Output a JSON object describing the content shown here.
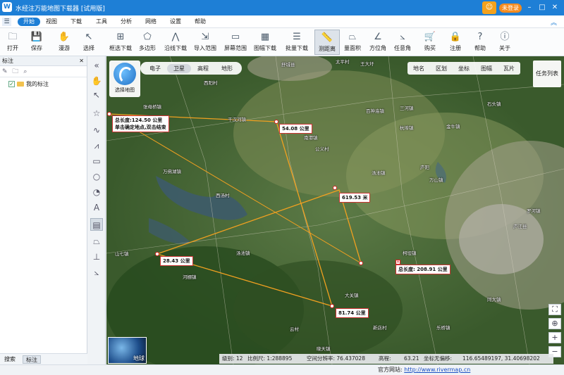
{
  "app": {
    "title": "水经注万能地图下载器 [试用版]",
    "login_label": "未登录"
  },
  "menu": {
    "items": [
      "开始",
      "视图",
      "下载",
      "工具",
      "分析",
      "网络",
      "设置",
      "帮助"
    ]
  },
  "toolbar": {
    "items": [
      "打开",
      "保存",
      "漫游",
      "选择",
      "框选下载",
      "多边形",
      "沿线下载",
      "导入范围",
      "屏幕范围",
      "图幅下载",
      "批量下载",
      "测距离",
      "量面积",
      "方位角",
      "任意角",
      "购买",
      "注册",
      "帮助",
      "关于"
    ],
    "active": "测距离"
  },
  "left_panel": {
    "title": "标注",
    "tree": [
      {
        "label": "我的标注",
        "checked": true
      }
    ],
    "tabs": [
      "搜索",
      "标注"
    ],
    "active_tab": "标注"
  },
  "map": {
    "select_map_label": "选择地图",
    "layers": [
      "电子",
      "卫星",
      "高程",
      "地形"
    ],
    "active_layer": "卫星",
    "overlays": [
      "地名",
      "区划",
      "坐标",
      "图幅",
      "瓦片"
    ],
    "task_list": "任务列表",
    "thumbnail_label": "地球",
    "places": [
      "舒城县",
      "太平村",
      "王大圩",
      "卫星",
      "西阳村",
      "张母桥镇",
      "干汉河镇",
      "南港镇",
      "公义村",
      "百神庙镇",
      "三河镇",
      "杭埠镇",
      "金牛镇",
      "石头镇",
      "汤池镇",
      "万山镇",
      "庐阳",
      "肥西",
      "高刘镇",
      "西汤村",
      "万佛湖镇",
      "东冲",
      "山七镇",
      "汤池镇",
      "河棚镇",
      "大关镇",
      "新店村",
      "云村",
      "晓天镇",
      "乐桥镇",
      "庐江县",
      "罗河镇",
      "汤池镇",
      "白湖镇",
      "合肥",
      "治父山",
      "南湾村",
      "柯坦镇",
      "乐桥村",
      "新街镇",
      "同大镇",
      "盛桥村",
      "乐桥镇",
      "旗山",
      "陈湾村",
      "长兴镇"
    ],
    "measure": {
      "total_label": "总长度:124.50 公里",
      "hint": "单击确定地点,双击结束",
      "segments": [
        "54.08 公里",
        "619.53 米",
        "28.43 公里",
        "81.74 公里"
      ],
      "total2": "总长度: 208.91 公里"
    },
    "status": {
      "level": "级别: 12",
      "scale": "比例尺: 1:288895",
      "resolution": "空间分辨率: 76.437028",
      "elevation_label": "高程:",
      "elevation": "63.21",
      "offset": "坐标无偏移:",
      "coords": "116.65489197, 31.40698202"
    }
  },
  "footer": {
    "site_label": "官方网站:",
    "url": "http://www.rivermap.cn"
  }
}
